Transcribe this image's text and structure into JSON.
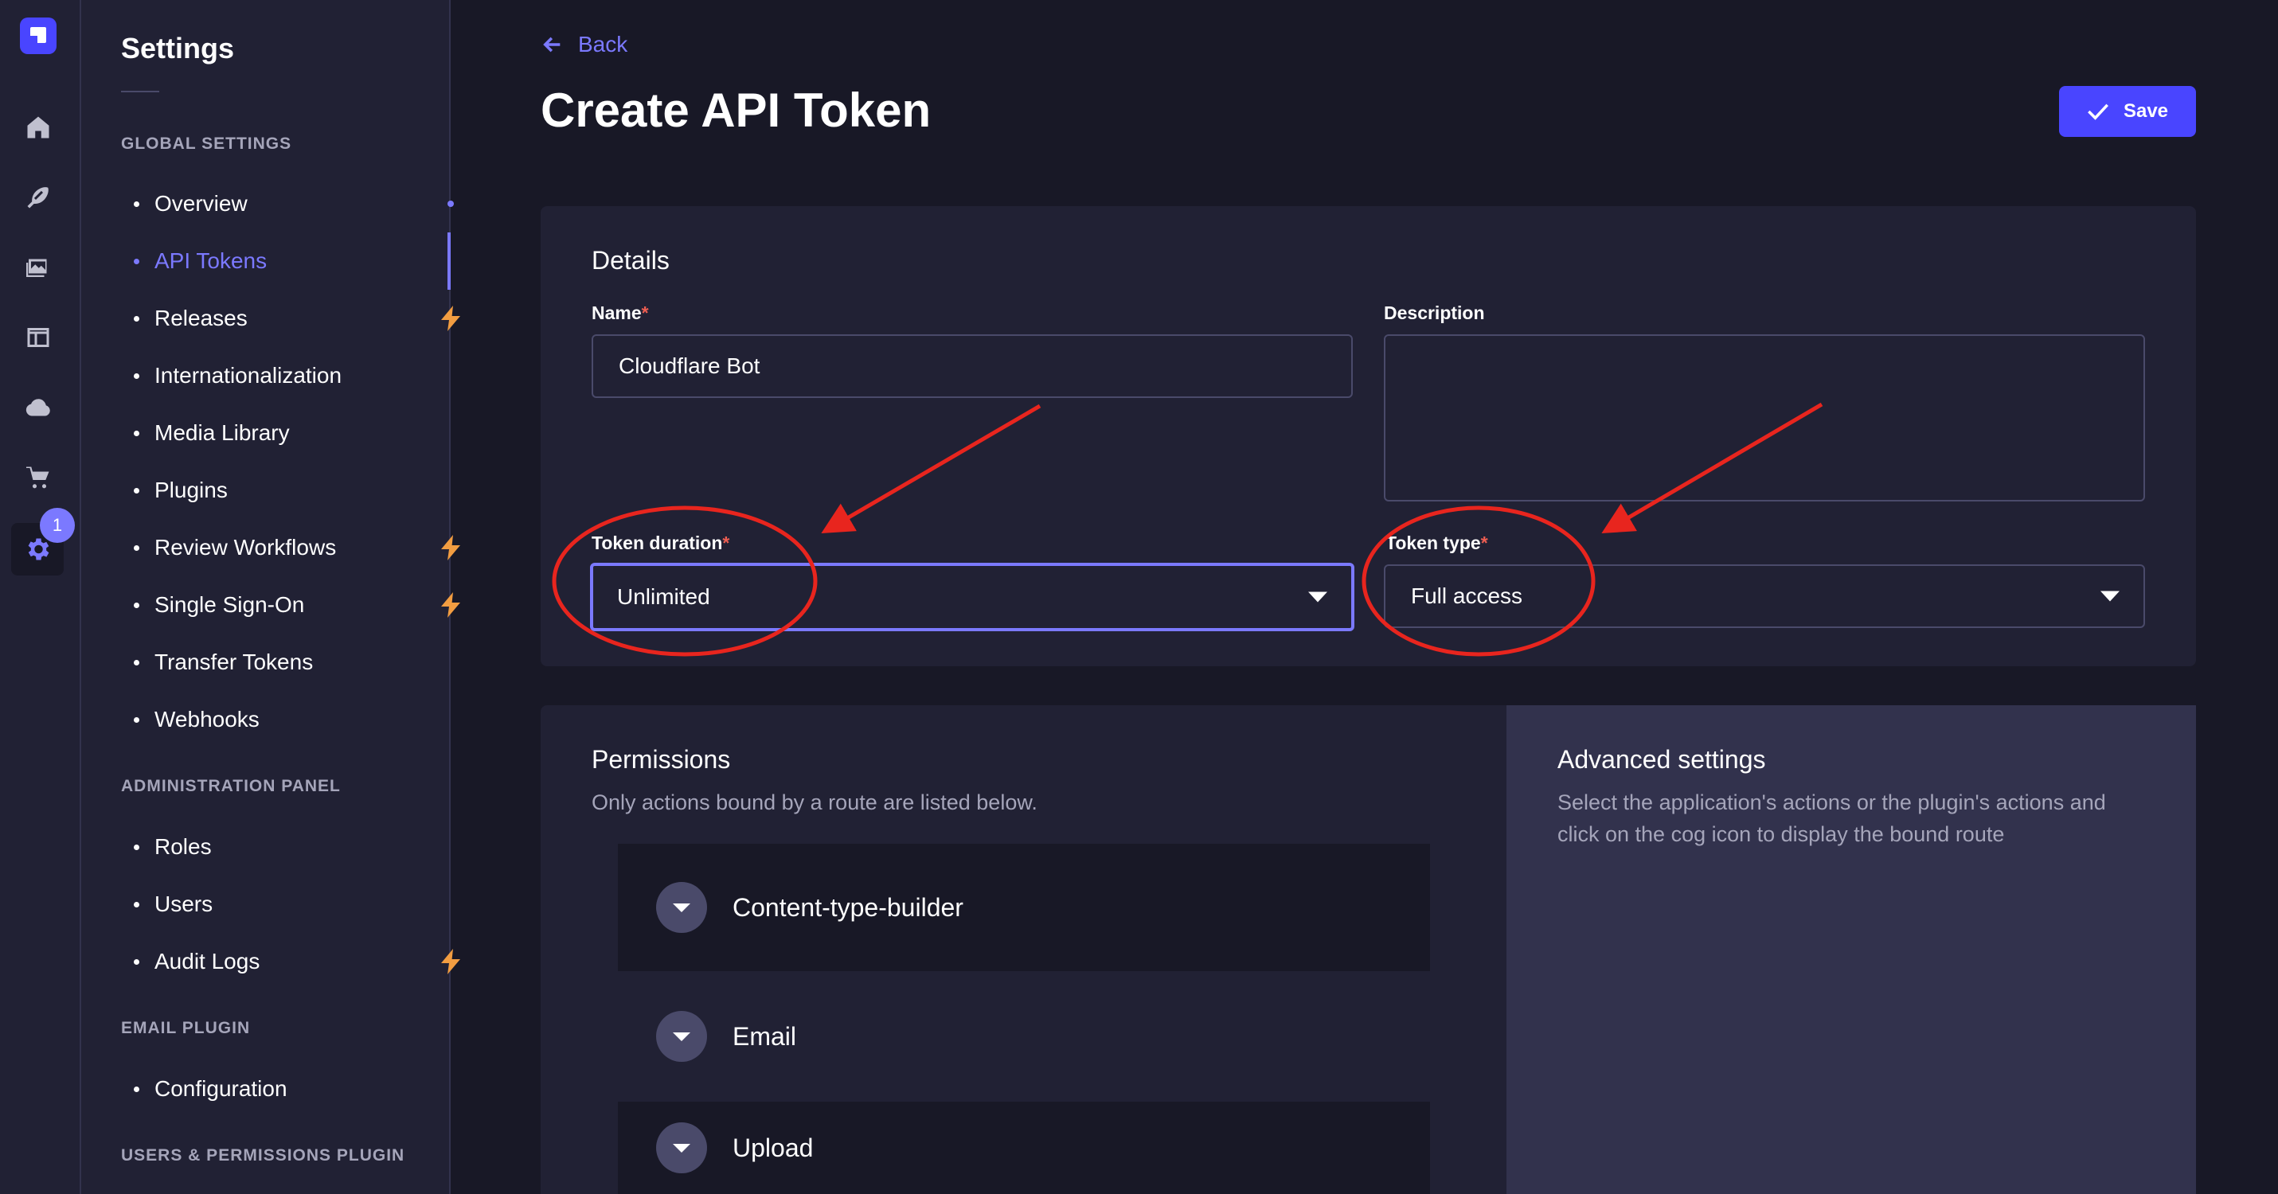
{
  "rail": {
    "badge_count": "1",
    "icons": [
      "home-icon",
      "feather-icon",
      "images-icon",
      "layout-icon",
      "cloud-icon",
      "cart-icon",
      "gear-icon"
    ]
  },
  "subnav": {
    "title": "Settings",
    "sections": [
      {
        "title": "GLOBAL SETTINGS",
        "items": [
          {
            "label": "Overview",
            "marker": "dot"
          },
          {
            "label": "API Tokens",
            "active": true
          },
          {
            "label": "Releases",
            "marker": "bolt"
          },
          {
            "label": "Internationalization"
          },
          {
            "label": "Media Library"
          },
          {
            "label": "Plugins"
          },
          {
            "label": "Review Workflows",
            "marker": "bolt"
          },
          {
            "label": "Single Sign-On",
            "marker": "bolt"
          },
          {
            "label": "Transfer Tokens"
          },
          {
            "label": "Webhooks"
          }
        ]
      },
      {
        "title": "ADMINISTRATION PANEL",
        "items": [
          {
            "label": "Roles"
          },
          {
            "label": "Users"
          },
          {
            "label": "Audit Logs",
            "marker": "bolt"
          }
        ]
      },
      {
        "title": "EMAIL PLUGIN",
        "items": [
          {
            "label": "Configuration"
          }
        ]
      },
      {
        "title": "USERS & PERMISSIONS PLUGIN",
        "items": []
      }
    ]
  },
  "header": {
    "back_label": "Back",
    "title": "Create API Token",
    "save_label": "Save"
  },
  "details": {
    "heading": "Details",
    "name_label": "Name",
    "name_value": "Cloudflare Bot",
    "description_label": "Description",
    "description_value": "",
    "duration_label": "Token duration",
    "duration_value": "Unlimited",
    "type_label": "Token type",
    "type_value": "Full access",
    "required_mark": "*"
  },
  "permissions": {
    "heading": "Permissions",
    "subtitle": "Only actions bound by a route are listed below.",
    "groups": [
      "Content-type-builder",
      "Email",
      "Upload"
    ]
  },
  "advanced": {
    "heading": "Advanced settings",
    "description": "Select the application's actions or the plugin's actions and click on the cog icon to display the bound route"
  },
  "colors": {
    "accent": "#4945ff",
    "accent_light": "#7b79ff",
    "warning": "#f29d41",
    "danger": "#ee5e52",
    "annotation": "#e8251e"
  }
}
